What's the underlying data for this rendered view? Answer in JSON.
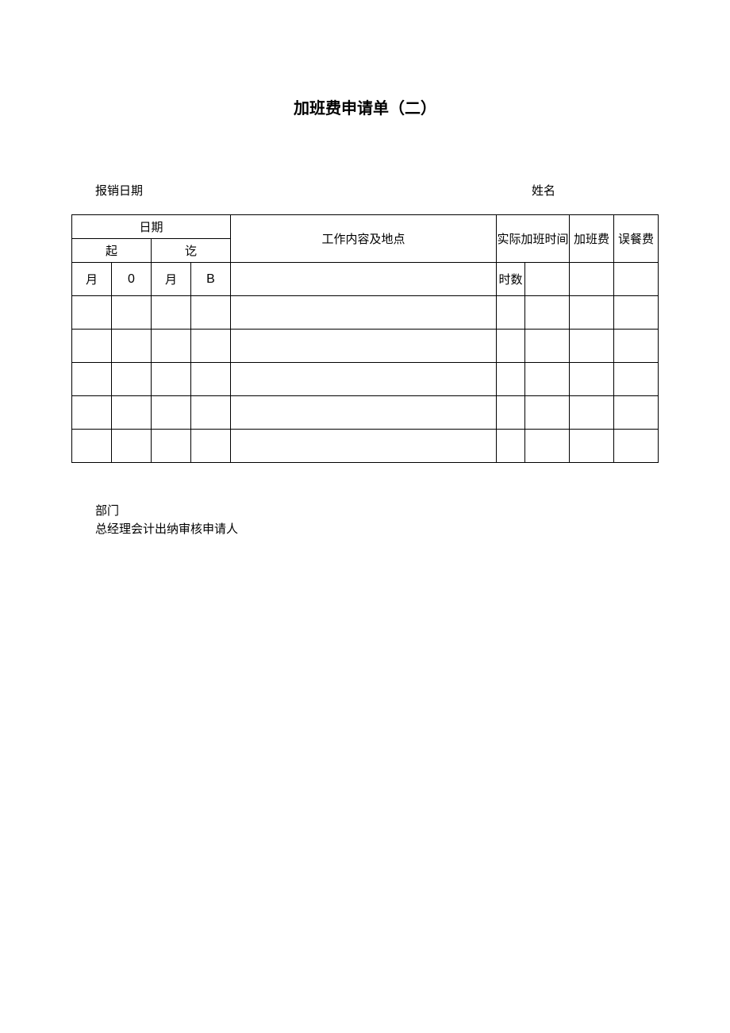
{
  "form": {
    "title": "加班费申请单（二）",
    "reimburse_date_label": "报销日期",
    "name_label": "姓名"
  },
  "table": {
    "date_header": "日期",
    "start_label": "起",
    "end_label": "讫",
    "content_header": "工作内容及地点",
    "actual_time_header": "实际加班时间",
    "overtime_fee_header": "加班费",
    "meal_fee_header": "误餐费",
    "month_label_1": "月",
    "day_label_1": "0",
    "month_label_2": "月",
    "day_label_2": "B",
    "hours_unit_label": "时数"
  },
  "rows": [
    {
      "m1": "",
      "d1": "",
      "m2": "",
      "d2": "",
      "content": "",
      "unit": "",
      "hours": "",
      "fee": "",
      "meal": ""
    },
    {
      "m1": "",
      "d1": "",
      "m2": "",
      "d2": "",
      "content": "",
      "unit": "",
      "hours": "",
      "fee": "",
      "meal": ""
    },
    {
      "m1": "",
      "d1": "",
      "m2": "",
      "d2": "",
      "content": "",
      "unit": "",
      "hours": "",
      "fee": "",
      "meal": ""
    },
    {
      "m1": "",
      "d1": "",
      "m2": "",
      "d2": "",
      "content": "",
      "unit": "",
      "hours": "",
      "fee": "",
      "meal": ""
    },
    {
      "m1": "",
      "d1": "",
      "m2": "",
      "d2": "",
      "content": "",
      "unit": "",
      "hours": "",
      "fee": "",
      "meal": ""
    }
  ],
  "footer": {
    "dept_label": "部门",
    "sign_line": "总经理会计出纳审核申请人"
  }
}
